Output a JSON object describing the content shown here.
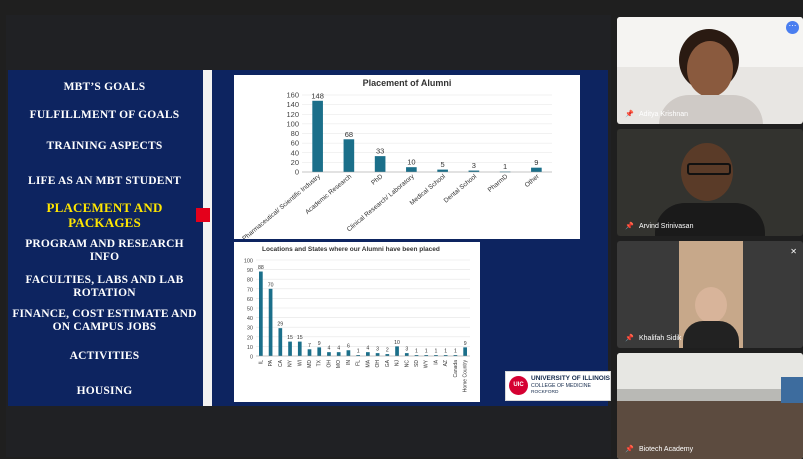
{
  "menu": {
    "items": [
      {
        "label": "MBT’S GOALS"
      },
      {
        "label": "FULFILLMENT OF GOALS"
      },
      {
        "label": "TRAINING ASPECTS"
      },
      {
        "label": "LIFE AS AN MBT STUDENT"
      },
      {
        "label": "PLACEMENT AND PACKAGES"
      },
      {
        "label": "PROGRAM AND RESEARCH INFO"
      },
      {
        "label": "FACULTIES, LABS AND LAB ROTATION"
      },
      {
        "label": "FINANCE, COST ESTIMATE AND ON CAMPUS JOBS"
      },
      {
        "label": "ACTIVITIES"
      },
      {
        "label": "HOUSING"
      }
    ]
  },
  "logo": {
    "badge": "UIC",
    "line1": "UNIVERSITY OF ILLINOIS",
    "line2": "COLLEGE OF MEDICINE",
    "line3": "ROCKFORD"
  },
  "participants": [
    {
      "name": "Aditya Krishnan"
    },
    {
      "name": "Arvind Srinivasan"
    },
    {
      "name": "Khalifah Sidik"
    },
    {
      "name": "Biotech Academy"
    }
  ],
  "colors": {
    "bar": "#1b6f8a",
    "slide_bg": "#0d2460",
    "active": "#ffe600",
    "marker": "#e4001b"
  },
  "chart_data": [
    {
      "type": "bar",
      "title": "Placement of Alumni",
      "categories": [
        "Pharmaceutical/ Scientific Industry",
        "Academic Research",
        "PhD",
        "Clinical Research/ Laboratory",
        "Medical School",
        "Dental School",
        "PharmD",
        "Other"
      ],
      "values": [
        148,
        68,
        33,
        10,
        5,
        3,
        1,
        9
      ],
      "ylim": [
        0,
        160
      ],
      "yticks": [
        0,
        20,
        40,
        60,
        80,
        100,
        120,
        140,
        160
      ]
    },
    {
      "type": "bar",
      "title": "Locations and States where our Alumni have been placed",
      "categories": [
        "IL",
        "PA",
        "CA",
        "NY",
        "WI",
        "MD",
        "TX",
        "OH",
        "MO",
        "IN",
        "FL",
        "MA",
        "OH",
        "GA",
        "NJ",
        "NC",
        "SD",
        "WY",
        "IA",
        "AZ",
        "Canada",
        "Home Country"
      ],
      "values": [
        88,
        70,
        29,
        15,
        15,
        7,
        9,
        4,
        4,
        6,
        1,
        4,
        3,
        2,
        10,
        3,
        1,
        1,
        1,
        1,
        1,
        9
      ],
      "ylim": [
        0,
        100
      ],
      "yticks": [
        0,
        10,
        20,
        30,
        40,
        50,
        60,
        70,
        80,
        90,
        100
      ]
    }
  ]
}
